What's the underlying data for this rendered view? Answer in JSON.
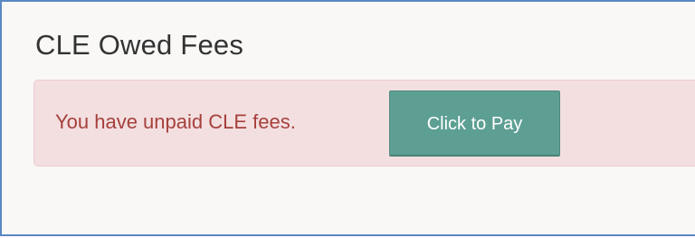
{
  "page": {
    "title": "CLE Owed Fees"
  },
  "alert": {
    "message": "You have unpaid CLE fees.",
    "pay_button_label": "Click to Pay"
  },
  "colors": {
    "frame_border": "#5b87c4",
    "alert_background": "#f3dfe0",
    "alert_text": "#a6403c",
    "button_background": "#5d9f93",
    "button_text": "#ffffff"
  }
}
